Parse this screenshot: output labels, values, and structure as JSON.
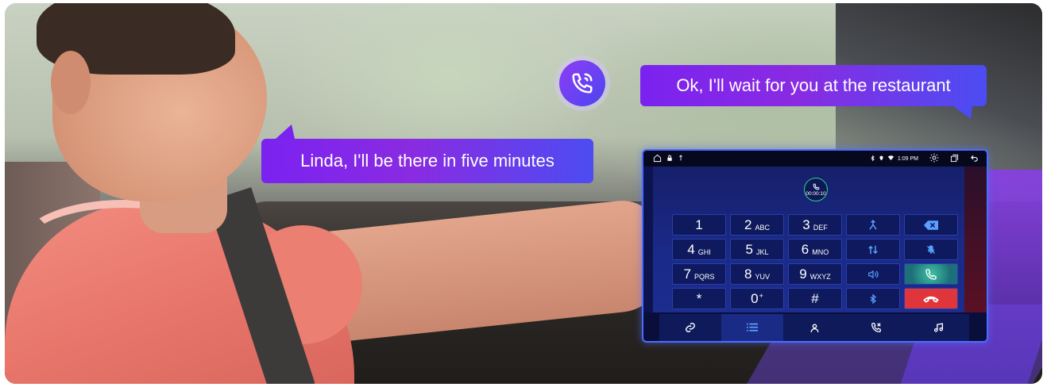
{
  "bubbles": {
    "driver": "Linda, I'll be there in five minutes",
    "reply": "Ok, I'll wait for you at the restaurant"
  },
  "device": {
    "status_time": "1:09 PM",
    "call_timer": "00:00:10",
    "keypad": [
      {
        "main": "1",
        "sub": ""
      },
      {
        "main": "2",
        "sub": "ABC"
      },
      {
        "main": "3",
        "sub": "DEF"
      },
      {
        "icon": "merge-call-icon"
      },
      {
        "icon": "backspace-icon"
      },
      {
        "main": "4",
        "sub": "GHI"
      },
      {
        "main": "5",
        "sub": "JKL"
      },
      {
        "main": "6",
        "sub": "MNO"
      },
      {
        "icon": "swap-call-icon"
      },
      {
        "icon": "mic-mute-icon"
      },
      {
        "main": "7",
        "sub": "PQRS"
      },
      {
        "main": "8",
        "sub": "YUV"
      },
      {
        "main": "9",
        "sub": "WXYZ"
      },
      {
        "icon": "speaker-icon"
      },
      {
        "icon": "call-icon"
      },
      {
        "main": "*",
        "sub": ""
      },
      {
        "main": "0",
        "sub": "+"
      },
      {
        "main": "#",
        "sub": ""
      },
      {
        "icon": "bluetooth-icon"
      },
      {
        "icon": "hang-up-icon"
      }
    ],
    "tabs": [
      "link-icon",
      "list-icon",
      "contacts-icon",
      "call-log-icon",
      "music-icon"
    ],
    "colors": {
      "accent": "#7a22f0",
      "call_green": "#3fc2a2",
      "hang_red": "#e0353a"
    }
  }
}
